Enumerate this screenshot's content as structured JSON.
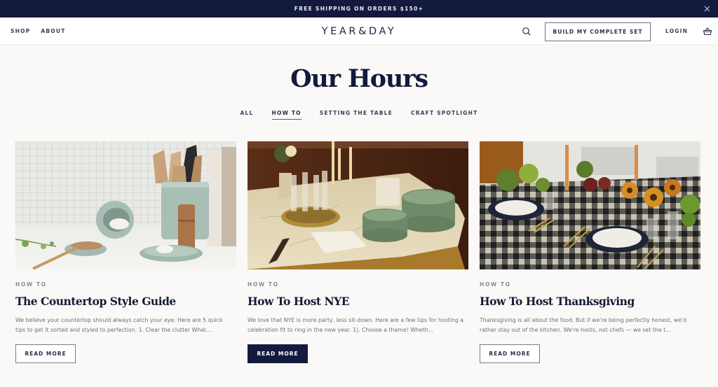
{
  "announcement": {
    "text": "FREE SHIPPING ON ORDERS $150+",
    "close_icon": "close-icon"
  },
  "header": {
    "nav_left": [
      {
        "label": "SHOP"
      },
      {
        "label": "ABOUT"
      }
    ],
    "logo": "YEAR&DAY",
    "search_icon": "search-icon",
    "cta_label": "BUILD MY COMPLETE SET",
    "login_label": "LOGIN",
    "cart_icon": "basket-icon"
  },
  "page": {
    "title": "Our Hours",
    "tabs": [
      {
        "label": "ALL",
        "active": false
      },
      {
        "label": "HOW TO",
        "active": true
      },
      {
        "label": "SETTING THE TABLE",
        "active": false
      },
      {
        "label": "CRAFT SPOTLIGHT",
        "active": false
      }
    ]
  },
  "articles": [
    {
      "category": "HOW TO",
      "title": "The Countertop Style Guide",
      "excerpt": "We believe your countertop should always catch your eye. Here are 5 quick tips to get it sorted and styled to perfection. 1. Clear the clutter What...",
      "button_label": "READ MORE",
      "image_alt": "Sage ceramic utensil crock, salt cellar and spoon rest on a white tiled countertop"
    },
    {
      "category": "HOW TO",
      "title": "How To Host NYE",
      "excerpt": "We love that NYE is more party, less sit-down. Here are a few tips for hosting a celebration fit to ring in the new year. 1). Choose a theme! Wheth...",
      "button_label": "READ MORE",
      "image_alt": "Marble bar with champagne flutes, candles and stacks of green plates"
    },
    {
      "category": "HOW TO",
      "title": "How To Host Thanksgiving",
      "excerpt": "Thanksgiving is all about the food. But if we're being perfectly honest, we'd rather stay out of the kitchen. We're hosts, not chefs — we set the t...",
      "button_label": "READ MORE",
      "image_alt": "Gingham tablecloth table set with plates, candles and sunflower arrangements"
    }
  ],
  "colors": {
    "navy": "#141a3e",
    "background": "#faf9f7",
    "muted_text": "#6e6f78"
  }
}
